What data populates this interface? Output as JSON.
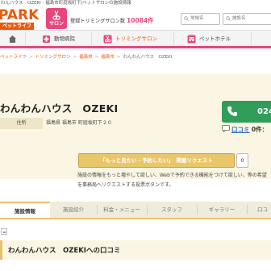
{
  "top_strip": "わんハウス　OZEKI - 福島市町庭坂町下|ペットサロンの施設情報",
  "header": {
    "logo_text": "PARK",
    "logo_sub": "ペットライフ",
    "salon_badge": "サロン",
    "registered_label": "登録トリミングサロン数",
    "registered_count": "10084件",
    "area_placeholder": "地域名",
    "facility_placeholder": "施設名"
  },
  "nav": {
    "vet": "動物病院",
    "trimming": "トリミングサロン",
    "hotel": "ペットホテル"
  },
  "breadcrumb": [
    "ペットライフ",
    "トリミングサロン",
    "福島県",
    "福島市",
    "わんわんハウス　OZEKI"
  ],
  "facility": {
    "name": "わんわんハウス　OZEKI",
    "address_label": "住所",
    "address": "福島県 福島市 町庭坂町下２０",
    "tel_partial": "024",
    "review_label": "口コミ",
    "review_count": "0件："
  },
  "request": {
    "button_label": "「もっと見たい・予約したい」　掲載リクエスト",
    "count": "0",
    "description": "施設の情報をもっと増やして欲しい、Webで予約できる機能をつけて欲しい、等の希望を事務局へリクエストする投票ボタンです。"
  },
  "tabs": [
    "施設情報",
    "施設紹介",
    "料金・メニュー",
    "スタッフ",
    "ギャラリー",
    "口コ"
  ],
  "active_tab": 0,
  "review_section_title": "わんわんハウス　OZEKIへの口コミ",
  "colors": {
    "brand_orange": "#ea5a0c",
    "salon_pink": "#e8467c",
    "tel_green": "#2f9e5a",
    "request_gold": "#e9c66a",
    "section_cream": "#fbf6e4"
  }
}
